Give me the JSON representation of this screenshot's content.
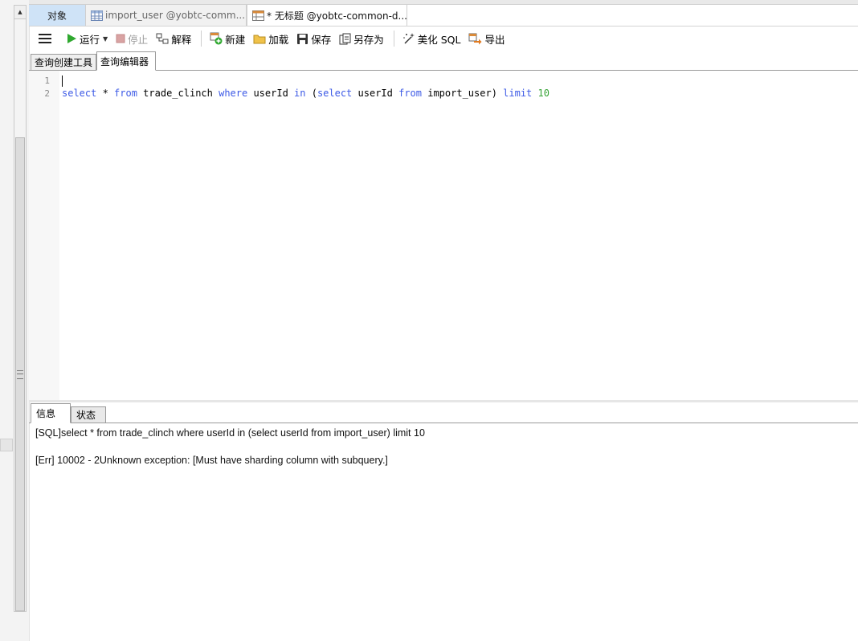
{
  "tabs": {
    "objects": "对象",
    "tab1": "import_user @yobtc-comm...",
    "tab2": "* 无标题 @yobtc-common-d..."
  },
  "toolbar": {
    "run": "运行",
    "stop": "停止",
    "explain": "解释",
    "new": "新建",
    "load": "加载",
    "save": "保存",
    "save_as": "另存为",
    "beautify": "美化 SQL",
    "export": "导出"
  },
  "subtabs": {
    "builder": "查询创建工具",
    "editor": "查询编辑器"
  },
  "editor": {
    "line1": "1",
    "line2": "2",
    "tokens": [
      {
        "t": "select",
        "k": true
      },
      {
        "t": " * ",
        "k": false
      },
      {
        "t": "from",
        "k": true
      },
      {
        "t": " trade_clinch ",
        "k": false
      },
      {
        "t": "where",
        "k": true
      },
      {
        "t": " userId ",
        "k": false
      },
      {
        "t": "in",
        "k": true
      },
      {
        "t": " (",
        "k": false
      },
      {
        "t": "select",
        "k": true
      },
      {
        "t": " userId ",
        "k": false
      },
      {
        "t": "from",
        "k": true
      },
      {
        "t": " import_user) ",
        "k": false
      },
      {
        "t": "limit",
        "k": true
      },
      {
        "t": " ",
        "k": false
      },
      {
        "t": "10",
        "n": true
      }
    ]
  },
  "bottom": {
    "info_tab": "信息",
    "status_tab": "状态",
    "sql_line": "[SQL]select * from trade_clinch where userId in (select userId from import_user) limit 10",
    "err_line": "[Err] 10002 - 2Unknown exception: [Must have sharding column with subquery.]"
  }
}
